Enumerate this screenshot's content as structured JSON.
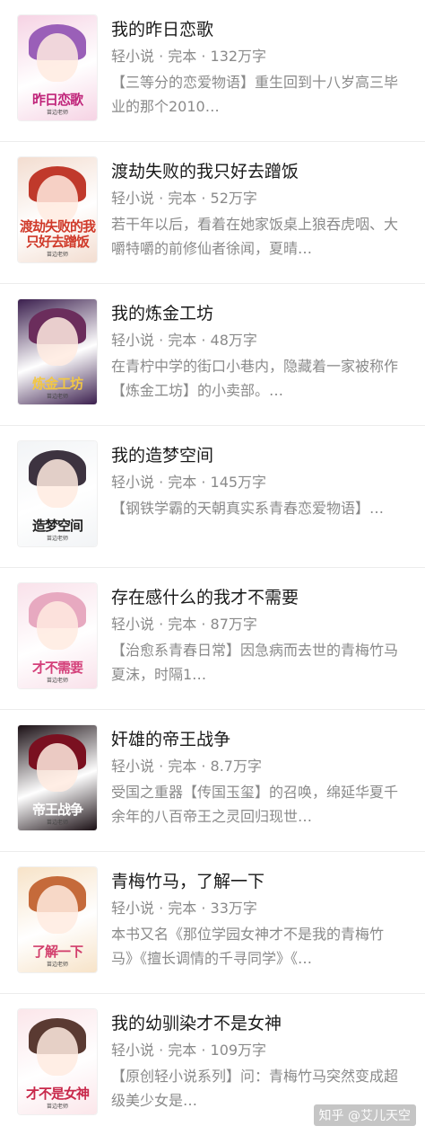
{
  "books": [
    {
      "title": "我的昨日恋歌",
      "meta": "轻小说 · 完本 · 132万字",
      "desc": "【三等分的恋爱物语】重生回到十八岁高三毕业的那个2010…",
      "cover_text": "昨日恋歌",
      "cover_author": "苗边老师",
      "colors": {
        "bg": "#f6d3e4",
        "hair": "#9a5fb8",
        "title": "#c0247a"
      }
    },
    {
      "title": "渡劫失败的我只好去蹭饭",
      "meta": "轻小说 · 完本 · 52万字",
      "desc": "若干年以后，看着在她家饭桌上狼吞虎咽、大嚼特嚼的前修仙者徐闻，夏晴…",
      "cover_text": "渡劫失败的我只好去蹭饭",
      "cover_author": "苗边老师",
      "colors": {
        "bg": "#f3ddd0",
        "hair": "#c0392b",
        "title": "#d03a2a"
      }
    },
    {
      "title": "我的炼金工坊",
      "meta": "轻小说 · 完本 · 48万字",
      "desc": "在青柠中学的街口小巷内，隐藏着一家被称作【炼金工坊】的小卖部。…",
      "cover_text": "炼金工坊",
      "cover_author": "苗边老师",
      "colors": {
        "bg": "#3b1f4e",
        "hair": "#6b2d5c",
        "title": "#f2c744"
      }
    },
    {
      "title": "我的造梦空间",
      "meta": "轻小说 · 完本 · 145万字",
      "desc": "【钢铁学霸的天朝真实系青春恋爱物语】…",
      "cover_text": "造梦空间",
      "cover_author": "苗边老师",
      "colors": {
        "bg": "#f2f4f6",
        "hair": "#3d3340",
        "title": "#222222"
      }
    },
    {
      "title": "存在感什么的我才不需要",
      "meta": "轻小说 · 完本 · 87万字",
      "desc": "【治愈系青春日常】因急病而去世的青梅竹马夏沫，时隔1…",
      "cover_text": "才不需要",
      "cover_author": "苗边老师",
      "colors": {
        "bg": "#f9e1ea",
        "hair": "#e7a9c0",
        "title": "#d4407a"
      }
    },
    {
      "title": "奸雄的帝王战争",
      "meta": "轻小说 · 完本 · 8.7万字",
      "desc": "受国之重器【传国玉玺】的召唤，绵延华夏千余年的八百帝王之灵回归现世…",
      "cover_text": "帝王战争",
      "cover_author": "苗边老师",
      "colors": {
        "bg": "#1a0f14",
        "hair": "#7a1020",
        "title": "#ffffff"
      }
    },
    {
      "title": "青梅竹马，了解一下",
      "meta": "轻小说 · 完本 · 33万字",
      "desc": "本书又名《那位学园女神才不是我的青梅竹马》《擅长调情的千寻同学》《…",
      "cover_text": "了解一下",
      "cover_author": "苗边老师",
      "colors": {
        "bg": "#f7e3c8",
        "hair": "#c56a3a",
        "title": "#d23d6b"
      }
    },
    {
      "title": "我的幼驯染才不是女神",
      "meta": "轻小说 · 完本 · 109万字",
      "desc": "【原创轻小说系列】问：青梅竹马突然变成超级美少女是…",
      "cover_text": "才不是女神",
      "cover_author": "苗边老师",
      "colors": {
        "bg": "#fbe6ea",
        "hair": "#5a3a32",
        "title": "#c8284a"
      }
    }
  ],
  "watermark": "知乎 @艾儿天空"
}
